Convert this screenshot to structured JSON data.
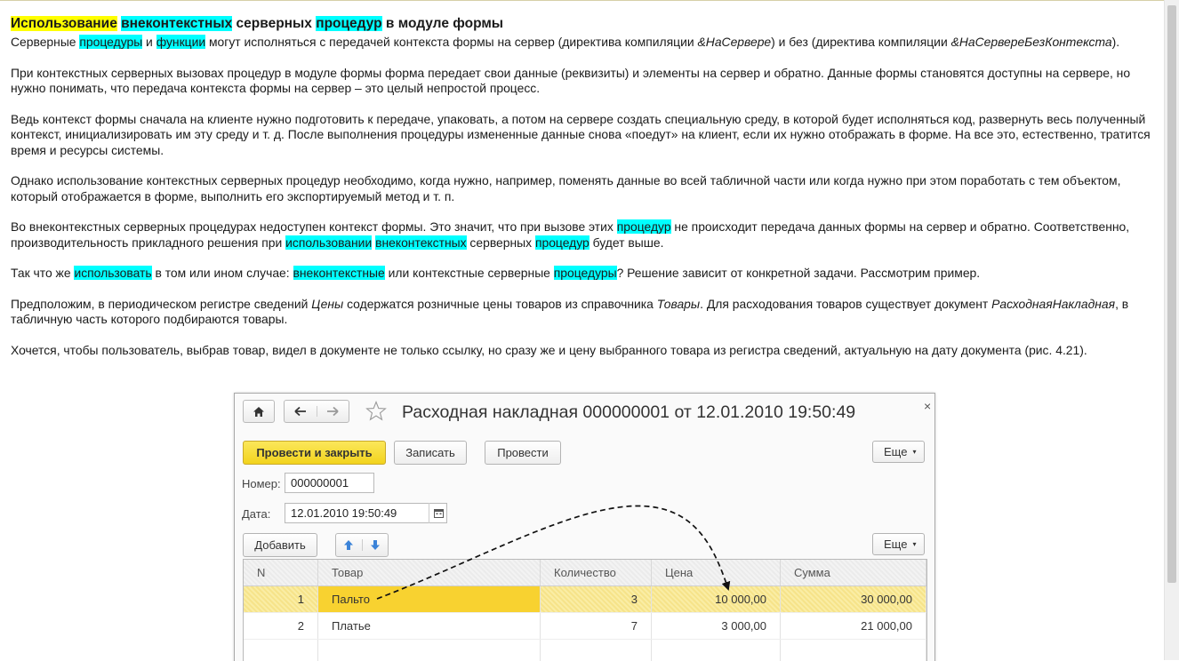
{
  "article": {
    "heading": {
      "w1": "Использование",
      "w2": "внеконтекстных",
      "w3": " серверных ",
      "w4": "процедур",
      "w5": " в модуле формы"
    },
    "p1": {
      "a": "Серверные ",
      "b": "процедуры",
      "c": " и ",
      "d": "функции",
      "e": " могут исполняться с передачей контекста формы на сервер (директива компиляции ",
      "f": "&НаСервере",
      "g": ") и без (директива компиляции ",
      "h": "&НаСервереБезКонтекста",
      "i": ")."
    },
    "p2": "При контекстных серверных вызовах процедур в модуле формы форма передает свои данные (реквизиты) и элементы на сервер и обратно. Данные формы становятся доступны на сервере, но нужно понимать, что передача контекста формы на сервер – это целый непростой процесс.",
    "p3": "Ведь контекст формы сначала на клиенте нужно подготовить к передаче, упаковать, а потом на сервере создать специальную среду, в которой будет исполняться код, развернуть весь полученный контекст, инициализировать им эту среду и т. д. После выполнения процедуры измененные данные снова «поедут» на клиент, если их нужно отображать в форме. На все это, естественно, тратится время и ресурсы системы.",
    "p4": "Однако использование контекстных серверных процедур необходимо, когда нужно, например, поменять данные во всей табличной части или когда нужно при этом поработать с тем объектом, который отображается в форме, выполнить его экспортируемый метод и т. п.",
    "p5": {
      "a": "Во внеконтекстных серверных процедурах недоступен контекст формы. Это значит, что при вызове этих ",
      "b": "процедур",
      "c": " не происходит передача данных формы на сервер и обратно. Соответственно, производительность прикладного решения при ",
      "d": "использовании",
      "e": " ",
      "f": "внеконтекстных",
      "g": " серверных ",
      "h": "процедур",
      "i": " будет выше."
    },
    "p6": {
      "a": "Так что же ",
      "b": "использовать",
      "c": " в том или ином случае: ",
      "d": "внеконтекстные",
      "e": " или контекстные серверные ",
      "f": "процедуры",
      "g": "? Решение зависит от конкретной задачи. Рассмотрим пример."
    },
    "p7": {
      "a": "Предположим, в периодическом регистре сведений ",
      "b": "Цены",
      "c": " содержатся розничные цены товаров из справочника ",
      "d": "Товары",
      "e": ". Для расходования товаров существует документ ",
      "f": "РасходнаяНакладная",
      "g": ", в табличную часть которого подбираются товары."
    },
    "p8": "Хочется, чтобы пользователь, выбрав товар, видел в документе не только ссылку, но сразу же и цену выбранного товара из регистра сведений, актуальную на дату документа (рис. 4.21)."
  },
  "form": {
    "title": "Расходная накладная 000000001 от 12.01.2010 19:50:49",
    "close": "×",
    "buttons": {
      "post_close": "Провести и закрыть",
      "save": "Записать",
      "post": "Провести",
      "more": "Еще",
      "add": "Добавить",
      "more2": "Еще"
    },
    "number_label": "Номер:",
    "number_value": "000000001",
    "date_label": "Дата:",
    "date_value": "12.01.2010 19:50:49",
    "table": {
      "columns": [
        "N",
        "Товар",
        "Количество",
        "Цена",
        "Сумма"
      ],
      "rows": [
        {
          "n": "1",
          "item": "Пальто",
          "qty": "3",
          "price": "10 000,00",
          "sum": "30 000,00"
        },
        {
          "n": "2",
          "item": "Платье",
          "qty": "7",
          "price": "3 000,00",
          "sum": "21 000,00"
        }
      ]
    }
  },
  "colors": {
    "highlight_yellow": "#ffff00",
    "highlight_cyan": "#00ffff",
    "primary_button": "#f2d31d",
    "selected_row": "#f6e38a"
  }
}
